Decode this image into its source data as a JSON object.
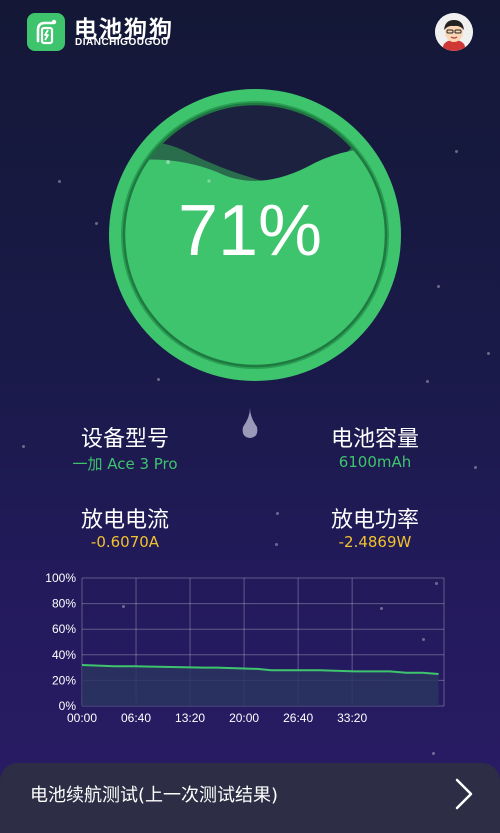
{
  "app": {
    "name": "电池狗狗",
    "subtitle": "DIANCHIGOUGOU"
  },
  "battery": {
    "percent_text": "71%",
    "level": 0.71
  },
  "info": {
    "model_label": "设备型号",
    "model_value": "一加 Ace 3 Pro",
    "capacity_label": "电池容量",
    "capacity_value": "6100mAh",
    "current_label": "放电电流",
    "current_value": "-0.6070A",
    "power_label": "放电功率",
    "power_value": "-2.4869W"
  },
  "chart_data": {
    "type": "area",
    "y_ticks": [
      "100%",
      "80%",
      "60%",
      "40%",
      "20%",
      "0%"
    ],
    "x_ticks": [
      "00:00",
      "06:40",
      "13:20",
      "20:00",
      "26:40",
      "33:20"
    ],
    "ylim": [
      0,
      100
    ],
    "grid": true,
    "series": [
      {
        "x_minutes": [
          0,
          240,
          380,
          900,
          1000,
          1300,
          1400,
          1660,
          1760,
          2020,
          2100,
          2280,
          2400,
          2520,
          2640
        ],
        "values": [
          32,
          31,
          31,
          30,
          30,
          29,
          28,
          28,
          28,
          27,
          27,
          27,
          26,
          26,
          25
        ]
      }
    ],
    "colors": {
      "line": "#3ec46d",
      "fill": "#2a3560"
    }
  },
  "bottom": {
    "label": "电池续航测试(上一次测试结果)"
  }
}
